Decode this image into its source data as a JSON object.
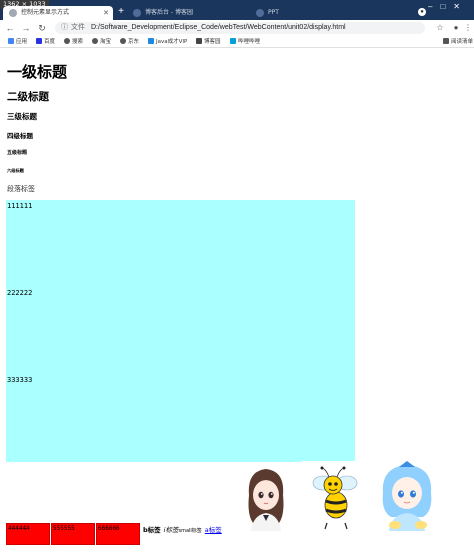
{
  "window": {
    "dimensions_label": "1362 × 1033"
  },
  "tabs": [
    {
      "label": "控制元素显示方式",
      "active": true
    },
    {
      "label": "博客后台 - 博客园",
      "active": false
    },
    {
      "label": "PPT",
      "active": false
    }
  ],
  "toolbar": {
    "info_label": "文件",
    "url": "D:/Software_Development/Eclipse_Code/webTest/WebContent/unit02/display.html"
  },
  "bookmarks": [
    {
      "label": "应用",
      "color": "#4285f4"
    },
    {
      "label": "百度",
      "color": "#2932e1"
    },
    {
      "label": "搜索",
      "color": "#555555"
    },
    {
      "label": "淘宝",
      "color": "#555555"
    },
    {
      "label": "京东",
      "color": "#555555"
    },
    {
      "label": "Java成才VIP",
      "color": "#1e88e5"
    },
    {
      "label": "博客园",
      "color": "#444444"
    },
    {
      "label": "哔哩哔哩",
      "color": "#00a1d6"
    },
    {
      "label": "阅读清单",
      "color": "#555555"
    }
  ],
  "content": {
    "h1": "一级标题",
    "h2": "二级标题",
    "h3": "三级标题",
    "h4": "四级标题",
    "h5": "五级标题",
    "h6": "六级标题",
    "paragraph": "段落标签",
    "cyan_items": [
      "111111",
      "222222",
      "333333"
    ],
    "red_items": [
      "444444",
      "555555",
      "666666"
    ],
    "b_tag": "b标签",
    "i_tag": "i标签",
    "small_tag": "small标签",
    "a_tag": "a标签"
  },
  "colors": {
    "cyan_block": "#aaffff",
    "red_block": "#ff0000",
    "tab_strip": "#1b365c",
    "link": "#0000ee"
  }
}
